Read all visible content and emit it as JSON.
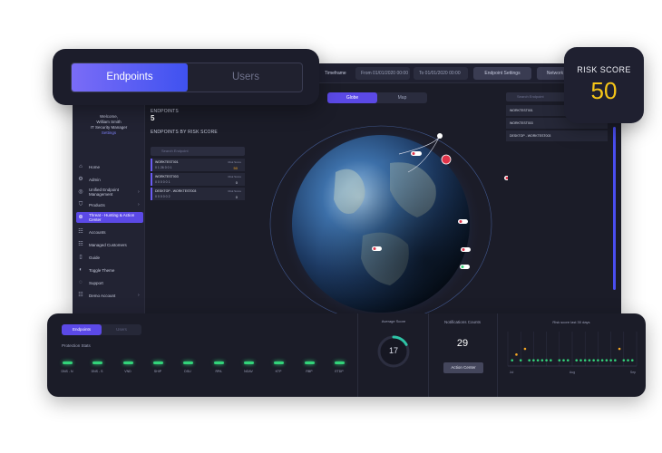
{
  "topbar": {
    "timeframe_label": "Timeframe",
    "from_placeholder": "From  01/01/2020  00:00",
    "to_placeholder": "To  01/01/2020  00:00",
    "endpoint_settings": "Endpoint Settings",
    "network": "Network"
  },
  "main_tabs": {
    "endpoints": "Endpoints",
    "users": "Users"
  },
  "risk": {
    "title": "RISK SCORE",
    "value": "50"
  },
  "sidebar": {
    "welcome": "Welcome,",
    "user_name": "William Smith",
    "user_role": "IT Security Manager",
    "settings_link": "Settings",
    "items": [
      {
        "icon": "home-icon",
        "label": "Home"
      },
      {
        "icon": "admin-icon",
        "label": "Admin"
      },
      {
        "icon": "uem-icon",
        "label": "Unified Endpoint Management"
      },
      {
        "icon": "shield-icon",
        "label": "Products"
      },
      {
        "icon": "globe-icon",
        "label": "Threat - Hunting & Action Center"
      },
      {
        "icon": "accounts-icon",
        "label": "Accounts"
      },
      {
        "icon": "customers-icon",
        "label": "Managed Customers"
      },
      {
        "icon": "guide-icon",
        "label": "Guide"
      },
      {
        "icon": "theme-icon",
        "label": "Toggle Theme"
      },
      {
        "icon": "support-icon",
        "label": "Support"
      },
      {
        "icon": "demo-icon",
        "label": "Demo Account"
      }
    ]
  },
  "endpoints_panel": {
    "title": "ENDPOINTS",
    "count": "5",
    "by_risk_title": "ENDPOINTS BY RISK SCORE",
    "search_placeholder": "Search Endpoint",
    "rows": [
      {
        "name": "WORKTEST001",
        "stats": "0   1   26   0   0   1",
        "score_label": "Risk Score",
        "score": "50"
      },
      {
        "name": "WORKTEST003",
        "stats": "0   0   0   0   0   1",
        "score_label": "Risk Score",
        "score": "0"
      },
      {
        "name": "DESKTOP - WORKTEST003",
        "stats": "0   0   0   0   0   2",
        "score_label": "Risk Score",
        "score": "0"
      }
    ]
  },
  "globe_tabs": {
    "globe": "Globe",
    "map": "Map"
  },
  "right_list": {
    "search_placeholder": "Search Endpoint",
    "rows": [
      {
        "name": "WORKTEST001"
      },
      {
        "name": "WORKTEST003"
      },
      {
        "name": "DESKTOP - WORKTEST003"
      }
    ]
  },
  "bottom": {
    "tabs": {
      "endpoints": "Endpoints",
      "users": "Users"
    },
    "protection_label": "Protection Stats",
    "protection": [
      "DNS - N",
      "DNS - S",
      "VND",
      "SHIP",
      "DSU",
      "RPA",
      "NGAV",
      "KTP",
      "RBP",
      "ETDP"
    ],
    "gauge": {
      "label": "Average Score",
      "value": "17",
      "fraction": 0.17
    },
    "notifications": {
      "label": "Notifications Counts",
      "value": "29",
      "button": "Action Center"
    },
    "chart_data": {
      "type": "scatter",
      "title": "Risk score last 30 days",
      "x_tick_labels": [
        "Jul",
        "Aug",
        "Sep"
      ],
      "points": [
        {
          "x": 1,
          "y": 1,
          "color": "#33d37a"
        },
        {
          "x": 2,
          "y": 2,
          "color": "#f5a623"
        },
        {
          "x": 3,
          "y": 1,
          "color": "#33d37a"
        },
        {
          "x": 4,
          "y": 3,
          "color": "#f5a623"
        },
        {
          "x": 5,
          "y": 1,
          "color": "#33d37a"
        },
        {
          "x": 6,
          "y": 1,
          "color": "#33d37a"
        },
        {
          "x": 7,
          "y": 1,
          "color": "#33d37a"
        },
        {
          "x": 8,
          "y": 1,
          "color": "#33d37a"
        },
        {
          "x": 9,
          "y": 1,
          "color": "#33d37a"
        },
        {
          "x": 10,
          "y": 1,
          "color": "#33d37a"
        },
        {
          "x": 12,
          "y": 1,
          "color": "#33d37a"
        },
        {
          "x": 13,
          "y": 1,
          "color": "#33d37a"
        },
        {
          "x": 14,
          "y": 1,
          "color": "#33d37a"
        },
        {
          "x": 16,
          "y": 1,
          "color": "#33d37a"
        },
        {
          "x": 17,
          "y": 1,
          "color": "#33d37a"
        },
        {
          "x": 18,
          "y": 1,
          "color": "#33d37a"
        },
        {
          "x": 19,
          "y": 1,
          "color": "#33d37a"
        },
        {
          "x": 20,
          "y": 1,
          "color": "#33d37a"
        },
        {
          "x": 21,
          "y": 1,
          "color": "#33d37a"
        },
        {
          "x": 22,
          "y": 1,
          "color": "#33d37a"
        },
        {
          "x": 23,
          "y": 1,
          "color": "#33d37a"
        },
        {
          "x": 24,
          "y": 1,
          "color": "#33d37a"
        },
        {
          "x": 25,
          "y": 1,
          "color": "#33d37a"
        },
        {
          "x": 26,
          "y": 3,
          "color": "#f5a623"
        },
        {
          "x": 27,
          "y": 1,
          "color": "#33d37a"
        },
        {
          "x": 28,
          "y": 1,
          "color": "#33d37a"
        },
        {
          "x": 29,
          "y": 1,
          "color": "#33d37a"
        }
      ],
      "xlim": [
        0,
        30
      ],
      "ylim": [
        0,
        6
      ]
    }
  },
  "colors": {
    "accent": "#5b49e6",
    "risk": "#f5c518",
    "ok": "#33d37a",
    "warn": "#f5a623"
  }
}
